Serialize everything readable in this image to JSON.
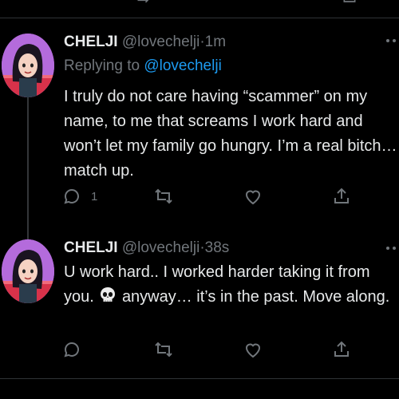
{
  "tweets": [
    {
      "display_name": "CHELJI",
      "handle": "@lovechelji",
      "separator": "·",
      "time": "1m",
      "replying_prefix": "Replying to",
      "replying_handle": "@lovechelji",
      "text": "I truly do not care having “scammer” on my name, to me that screams I work hard and won’t let my family go hungry. I’m a real bitch… match up.",
      "reply_count": "1"
    },
    {
      "display_name": "CHELJI",
      "handle": "@lovechelji",
      "separator": "·",
      "time": "38s",
      "text_before_emoji": "U work hard.. I worked harder taking it from you.",
      "emoji": "skull",
      "text_after_emoji": "anyway… it’s in the past. Move along.",
      "reply_count": ""
    }
  ],
  "icons": {
    "reply": "reply-icon",
    "retweet": "retweet-icon",
    "like": "heart-icon",
    "share": "share-icon",
    "more": "more-icon"
  },
  "colors": {
    "background": "#000000",
    "text": "#e7e9ea",
    "muted": "#71767b",
    "link": "#1d9bf0",
    "avatar_bg": "#b46bdc"
  }
}
